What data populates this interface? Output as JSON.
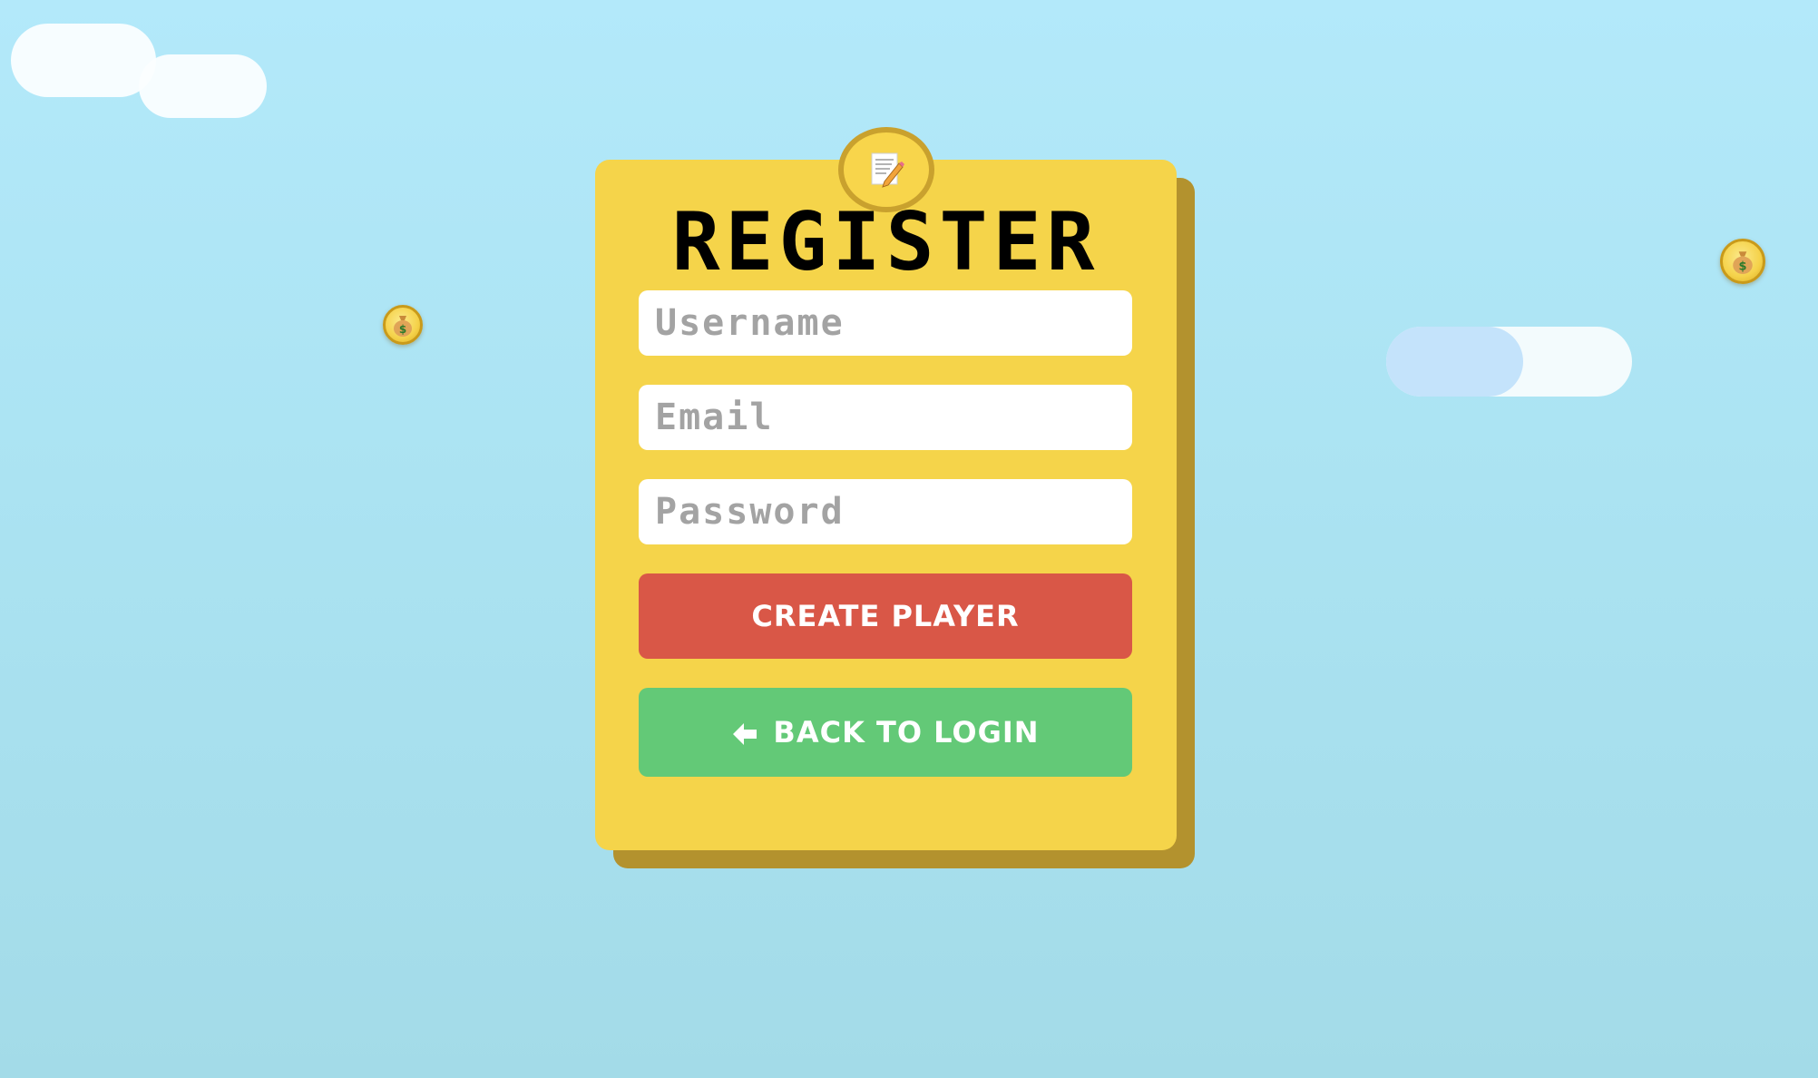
{
  "register_form": {
    "title": "REGISTER",
    "badge_icon": "memo-pencil-icon",
    "username": {
      "placeholder": "Username",
      "value": ""
    },
    "email": {
      "placeholder": "Email",
      "value": ""
    },
    "password": {
      "placeholder": "Password",
      "value": ""
    },
    "create_button_label": "CREATE PLAYER",
    "back_button_label": "BACK TO LOGIN",
    "back_button_icon": "arrow-left-icon"
  },
  "decorations": {
    "coin_icon": "money-bag-icon",
    "cloud_icon": "cloud-icon"
  },
  "colors": {
    "sky": "#b3e9fa",
    "card": "#f5d44a",
    "card_shadow": "#b3922e",
    "create_button": "#d95747",
    "back_button": "#63c977",
    "coin": "#f5d24a"
  }
}
